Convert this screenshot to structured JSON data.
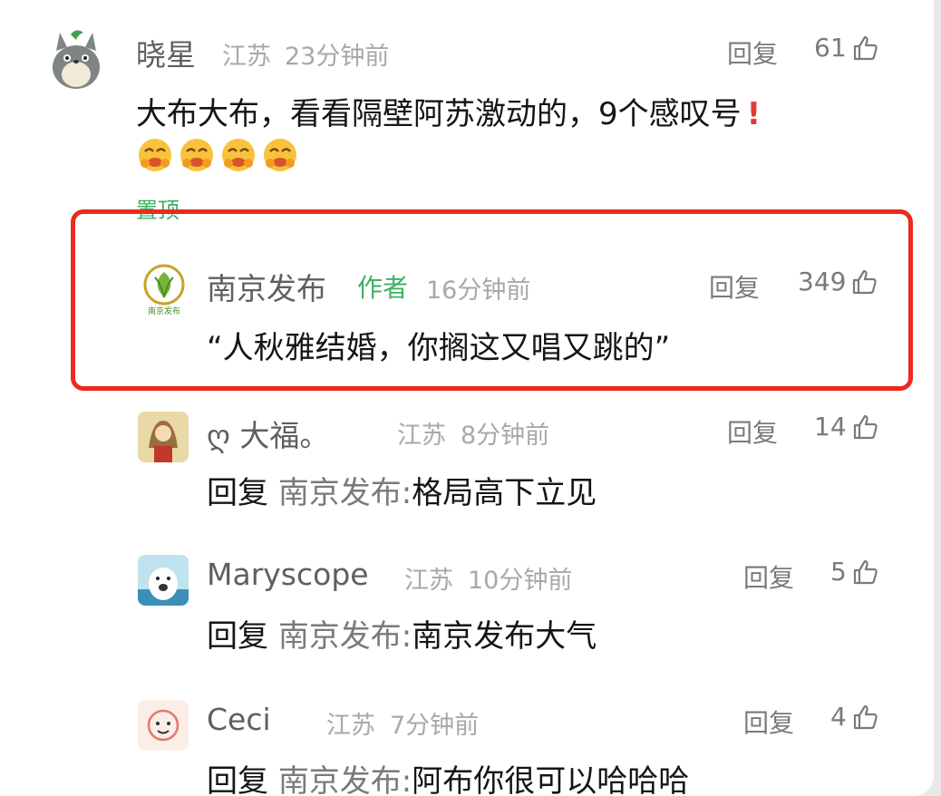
{
  "comments": [
    {
      "name": "晓星",
      "location": "江苏",
      "time": "23分钟前",
      "reply_label": "回复",
      "likes": "61",
      "text": "大布大布，看看隔壁阿苏激动的，9个感叹号",
      "pinned_label": "置顶",
      "avatar_icon": "totoro-avatar-icon"
    },
    {
      "name": "南京发布",
      "author_tag": "作者",
      "time": "16分钟前",
      "reply_label": "回复",
      "likes": "349",
      "text": "“人秋雅结婚，你搁这又唱又跳的”",
      "avatar_icon": "nanjing-fabu-logo-icon",
      "avatar_caption": "南京发布"
    },
    {
      "name": "ღ    大福。",
      "location": "江苏",
      "time": "8分钟前",
      "reply_label": "回复",
      "likes": "14",
      "reply_prefix": "回复",
      "reply_target": "南京发布:",
      "text": "格局高下立见",
      "avatar_icon": "girl-avatar-icon"
    },
    {
      "name": "Maryscope",
      "location": "江苏",
      "time": "10分钟前",
      "reply_label": "回复",
      "likes": "5",
      "reply_prefix": "回复",
      "reply_target": "南京发布:",
      "text": "南京发布大气",
      "avatar_icon": "cartoon-avatar-icon"
    },
    {
      "name": "Ceci",
      "location": "江苏",
      "time": "7分钟前",
      "reply_label": "回复",
      "likes": "4",
      "reply_prefix": "回复",
      "reply_target": "南京发布:",
      "text": "阿布你很可以哈哈哈",
      "avatar_icon": "doodle-avatar-icon"
    }
  ],
  "colors": {
    "highlight_border": "#ec2a1f",
    "author_tag": "#3db060",
    "pinned": "#3db060",
    "exclamation": "#e53935"
  }
}
